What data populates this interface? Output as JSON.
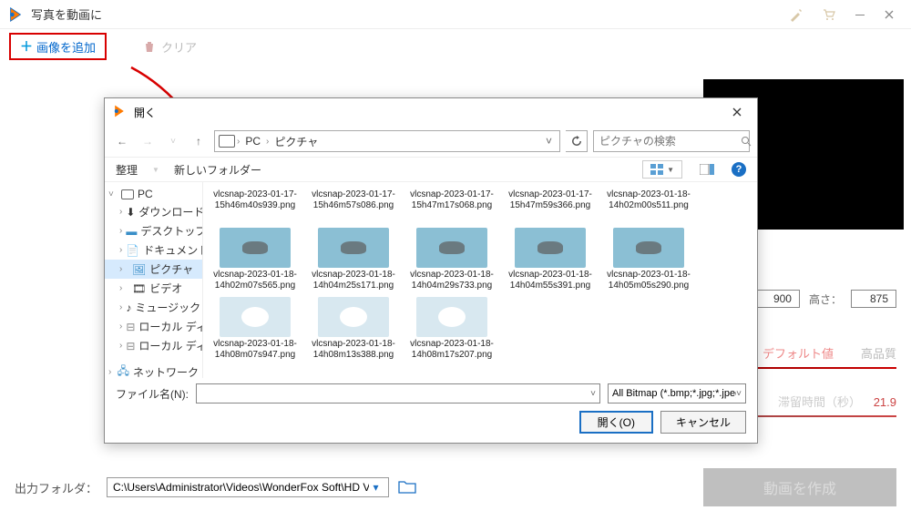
{
  "app": {
    "title": "写真を動画に"
  },
  "toolbar": {
    "add_label": "画像を追加",
    "clear_label": "クリア"
  },
  "right": {
    "width_val": "900",
    "height_label": "高さ：",
    "height_val": "875",
    "quality_default": "デフォルト値",
    "quality_high": "高品質",
    "dwell_label": "滞留時間（秒）",
    "dwell_val": "21.9"
  },
  "bottom": {
    "label": "出力フォルダ：",
    "path": "C:\\Users\\Administrator\\Videos\\WonderFox Soft\\HD Video Converter Factory Pro\\OutputVideo\\",
    "create_btn": "動画を作成"
  },
  "dialog": {
    "title": "開く",
    "crumb_pc": "PC",
    "crumb_folder": "ピクチャ",
    "search_placeholder": "ピクチャの検索",
    "organize": "整理",
    "new_folder": "新しいフォルダー",
    "file_name_label": "ファイル名(N):",
    "filter": "All Bitmap (*.bmp;*.jpg;*.jpeg;*",
    "open_btn": "開く(O)",
    "cancel_btn": "キャンセル",
    "tree": {
      "pc": "PC",
      "downloads": "ダウンロード",
      "desktop": "デスクトップ",
      "documents": "ドキュメント",
      "pictures": "ピクチャ",
      "videos": "ビデオ",
      "music": "ミュージック",
      "localdisk1": "ローカル ディスク (C",
      "localdisk2": "ローカル ディスク (D",
      "network": "ネットワーク"
    },
    "files": [
      {
        "name": "vlcsnap-2023-01-17-15h46m40s939.png"
      },
      {
        "name": "vlcsnap-2023-01-17-15h46m57s086.png"
      },
      {
        "name": "vlcsnap-2023-01-17-15h47m17s068.png"
      },
      {
        "name": "vlcsnap-2023-01-17-15h47m59s366.png"
      },
      {
        "name": "vlcsnap-2023-01-18-14h02m00s511.png"
      },
      {
        "name": "vlcsnap-2023-01-18-14h02m07s565.png"
      },
      {
        "name": "vlcsnap-2023-01-18-14h04m25s171.png"
      },
      {
        "name": "vlcsnap-2023-01-18-14h04m29s733.png"
      },
      {
        "name": "vlcsnap-2023-01-18-14h04m55s391.png"
      },
      {
        "name": "vlcsnap-2023-01-18-14h05m05s290.png"
      },
      {
        "name": "vlcsnap-2023-01-18-14h08m07s947.png"
      },
      {
        "name": "vlcsnap-2023-01-18-14h08m13s388.png"
      },
      {
        "name": "vlcsnap-2023-01-18-14h08m17s207.png"
      }
    ]
  }
}
